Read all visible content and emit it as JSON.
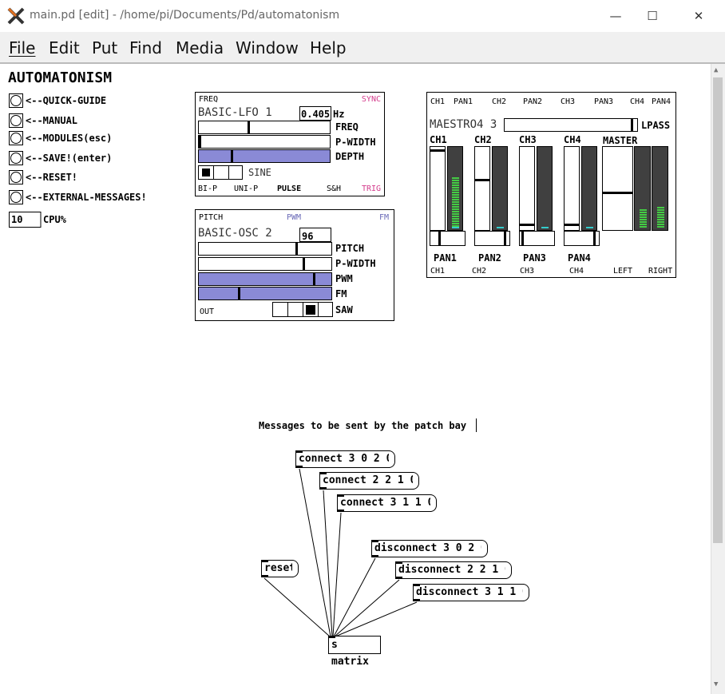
{
  "window": {
    "title": "main.pd  [edit] - /home/pi/Documents/Pd/automatonism",
    "minimize": "—",
    "maximize": "☐",
    "close": "✕"
  },
  "menu": [
    "File",
    "Edit",
    "Put",
    "Find",
    "Media",
    "Window",
    "Help"
  ],
  "left_panel": {
    "heading": "AUTOMATONISM",
    "buttons": [
      "<--QUICK-GUIDE",
      "<--MANUAL",
      "<--MODULES(esc)",
      "<--SAVE!(enter)",
      "<--RESET!",
      "<--EXTERNAL-MESSAGES!"
    ],
    "cpu_value": "10",
    "cpu_label": "CPU%"
  },
  "lfo": {
    "top_left": "FREQ",
    "top_right": "SYNC",
    "name": "BASIC-LFO 1",
    "freq_value": "0.405",
    "unit": "Hz",
    "sliders": [
      {
        "label": "FREQ",
        "value": 0.38,
        "style": "white"
      },
      {
        "label": "P-WIDTH",
        "value": 0.0,
        "style": "white"
      },
      {
        "label": "DEPTH",
        "value": 0.25,
        "style": "purple"
      }
    ],
    "wave_label": "SINE",
    "wave_selected": 0,
    "outputs": [
      "BI-P",
      "UNI-P",
      "PULSE",
      "S&H",
      "TRIG"
    ]
  },
  "osc": {
    "top_left": "PITCH",
    "top_mid": "PWM",
    "top_right": "FM",
    "name": "BASIC-OSC 2",
    "pitch_value": "96",
    "sliders": [
      {
        "label": "PITCH",
        "value": 0.74,
        "style": "white"
      },
      {
        "label": "P-WIDTH",
        "value": 0.8,
        "style": "white"
      },
      {
        "label": "PWM",
        "value": 0.88,
        "style": "purple"
      },
      {
        "label": "FM",
        "value": 0.3,
        "style": "purple"
      }
    ],
    "out_label": "OUT",
    "wave_label": "SAW",
    "wave_selected": 2
  },
  "mixer": {
    "top_labels": [
      "CH1",
      "PAN1",
      "CH2",
      "PAN2",
      "CH3",
      "PAN3",
      "CH4",
      "PAN4"
    ],
    "name": "MAESTRO4 3",
    "lpass_label": "LPASS",
    "lpass_value": 0.97,
    "channels": [
      {
        "label": "CH1",
        "level": 0.97,
        "pan_label": "PAN1",
        "pan": 0.25,
        "vu": 0.7
      },
      {
        "label": "CH2",
        "level": 0.6,
        "pan_label": "PAN2",
        "pan": 0.9,
        "vu": 0.0
      },
      {
        "label": "CH3",
        "level": 0.05,
        "pan_label": "PAN3",
        "pan": 0.05,
        "vu": 0.0
      },
      {
        "label": "CH4",
        "level": 0.05,
        "pan_label": "PAN4",
        "pan": 0.9,
        "vu": 0.0
      }
    ],
    "master_label": "MASTER",
    "master_level": 0.55,
    "master_vu": [
      0.2,
      0.22
    ],
    "bottom_labels": [
      "CH1",
      "CH2",
      "CH3",
      "CH4",
      "LEFT",
      "RIGHT"
    ]
  },
  "patch": {
    "comment": "Messages to be sent by the patch bay",
    "connect_msgs": [
      "connect 3 0 2 0",
      "connect 2 2 1 0",
      "connect 3 1 1 0"
    ],
    "disconnect_msgs": [
      "disconnect 3 0 2 0",
      "disconnect 2 2 1 0",
      "disconnect 3 1 1 0"
    ],
    "reset_msg": "reset",
    "send_object": "s matrix"
  },
  "colors": {
    "accent_purple": "#8a8ad6",
    "sync_pink": "#d43c8c",
    "pwm_blue": "#6b6bb8",
    "vu_green": "#44cc44",
    "vu_yellow": "#cccc44"
  }
}
